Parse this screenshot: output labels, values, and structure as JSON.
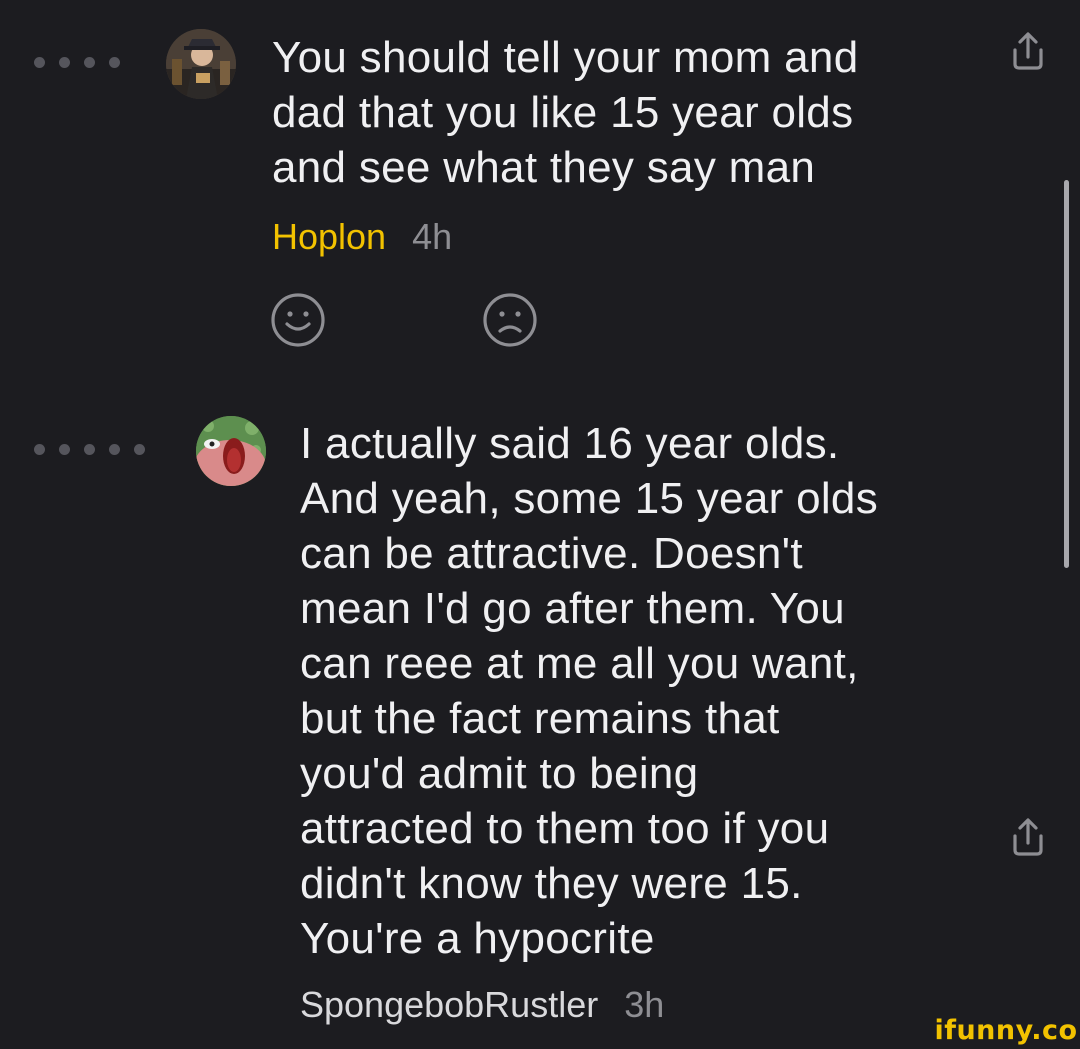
{
  "comments": [
    {
      "text": "You should tell your mom and\ndad that you like 15 year olds\nand see what they say man",
      "author": "Hoplon",
      "time": "4h",
      "thread_depth": 4,
      "author_highlight_color": "#f2c200",
      "avatar_icon": "avatar-hoplon-icon",
      "share_icon": "share-icon",
      "reaction_icons": [
        "smile-icon",
        "frown-icon"
      ]
    },
    {
      "text": "I actually said 16 year olds.\nAnd yeah, some 15 year olds\ncan be attractive. Doesn't\nmean I'd go after them. You\ncan reee at me all you want,\nbut the fact remains that\nyou'd admit to being\nattracted to them too if you\ndidn't know they were 15.\nYou're a hypocrite",
      "author": "SpongebobRustler",
      "time": "3h",
      "thread_depth": 5,
      "avatar_icon": "avatar-spongebobrustler-icon",
      "share_icon": "share-icon"
    }
  ],
  "watermark": "ifunny.co"
}
